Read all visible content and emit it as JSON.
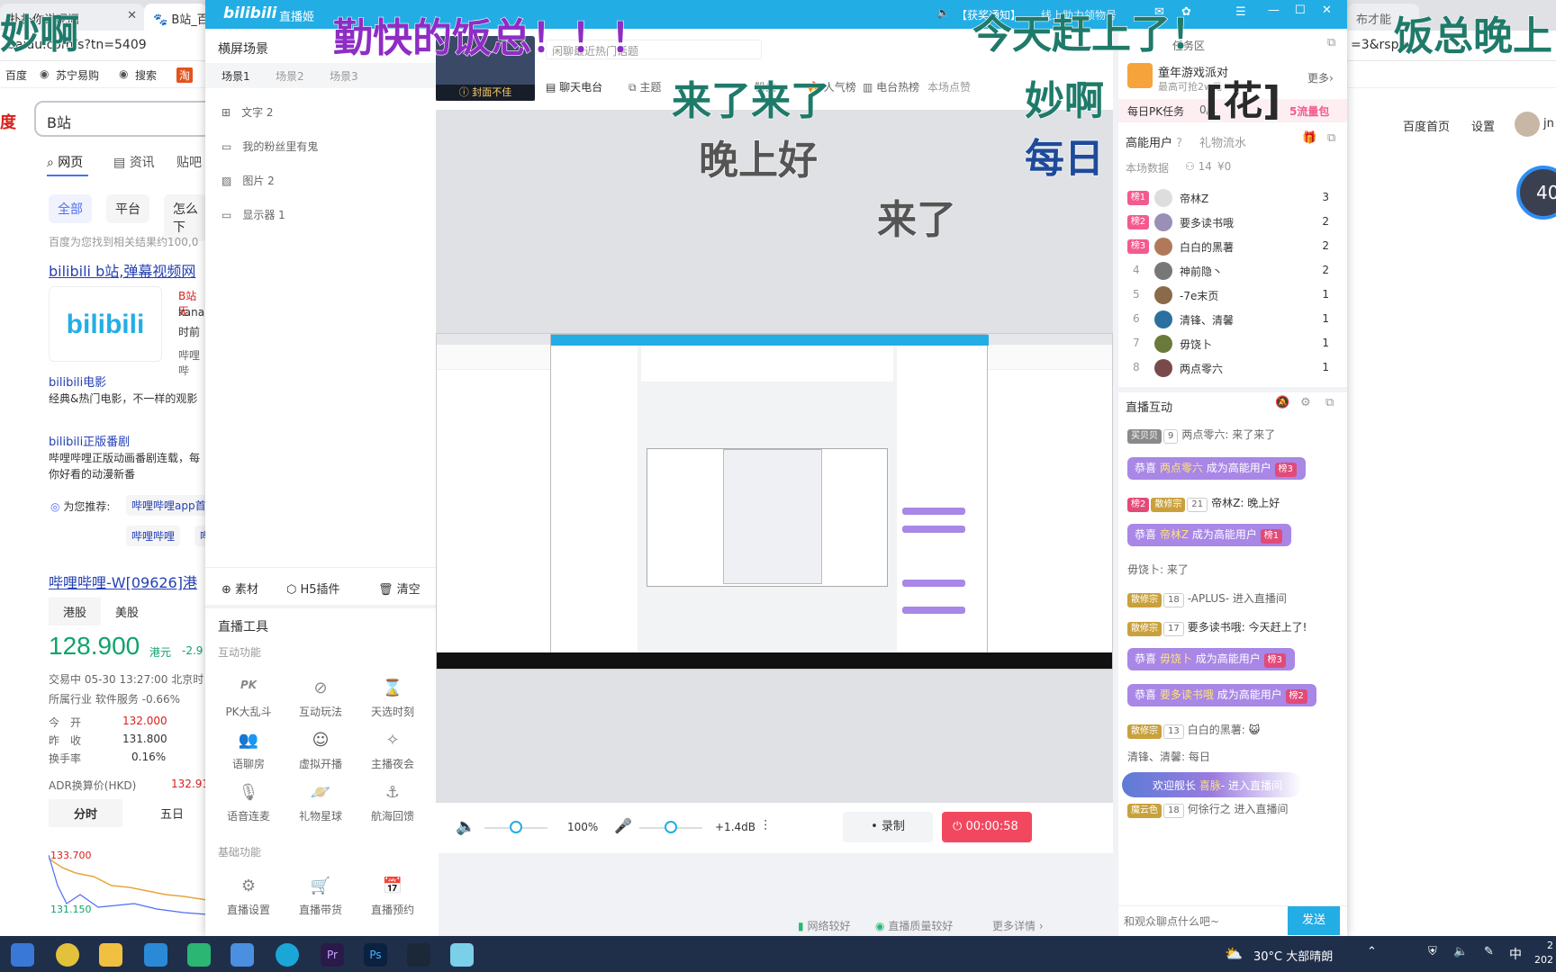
{
  "browser": {
    "tabs": [
      "扑扑你说呢问",
      "B站_百度"
    ],
    "url": "baidu.com/s?tn=5409",
    "url_tail": "=3&rsp=",
    "right_tab": "布才能",
    "bookmarks": [
      "百度",
      "苏宁易购",
      "搜索"
    ],
    "search_value": "B站",
    "search_tabs": [
      "网页",
      "资讯",
      "贴吧"
    ],
    "filters": [
      "全部",
      "平台",
      "怎么下"
    ],
    "result_count": "百度为您找到相关结果约100,0",
    "result1_title": "bilibili b站,弹幕视频网",
    "result1_snippet": [
      "B站无",
      "kana",
      "时前",
      "哔哩哔"
    ],
    "logo_text": "bilibili",
    "sub1_title": "bilibili电影",
    "sub1_desc": "经典&热门电影，不一样的观影",
    "sub2_title": "bilibili正版番剧",
    "sub2_desc": "哔哩哔哩正版动画番剧连载，每",
    "sub2_desc2": "你好看的动漫新番",
    "recommend_label": "为您推荐:",
    "recommend_items": [
      "哔哩哔哩app首",
      "哔哩哔哩",
      "哔"
    ],
    "stock_title": "哔哩哔哩-W[09626]港",
    "stock_tabs": [
      "港股",
      "美股"
    ],
    "stock_price": "128.900",
    "stock_unit": "港元",
    "stock_change": "-2.9",
    "stock_status": "交易中 05-30 13:27:00 北京时",
    "stock_industry": "所属行业 软件服务 -0.66%",
    "stock_rows": [
      {
        "k": "今　开",
        "v": "132.000"
      },
      {
        "k": "昨　收",
        "v": "131.800"
      },
      {
        "k": "换手率",
        "v": "0.16%"
      }
    ],
    "adr_label": "ADR换算价(HKD)",
    "adr_value": "132.91",
    "period_tabs": [
      "分时",
      "五日"
    ],
    "chart_high": "133.700",
    "chart_low": "131.150",
    "right_nav": [
      "百度首页",
      "设置"
    ],
    "right_user": "jn",
    "right_badge": "40"
  },
  "live": {
    "app_title": "直播姬",
    "title_notice": "【获奖通知】",
    "title_notice2": "线上助力领物号",
    "scene_panel_title": "横屏场景",
    "scene_tabs": [
      "场景1",
      "场景2",
      "场景3"
    ],
    "scene_items": [
      "文字 2",
      "我的粉丝里有鬼",
      "图片 2",
      "显示器 1"
    ],
    "scene_actions": [
      "素材",
      "H5插件",
      "清空"
    ],
    "tools_title": "直播工具",
    "interactive_title": "互动功能",
    "interactive_tools": [
      "PK大乱斗",
      "互动玩法",
      "天选时刻",
      "语聊房",
      "虚拟开播",
      "主播夜会",
      "语音连麦",
      "礼物星球",
      "航海回馈"
    ],
    "basic_title": "基础功能",
    "basic_tools": [
      "直播设置",
      "直播带货",
      "直播预约"
    ],
    "room_title_placeholder": "闲聊最近热门话题",
    "cover_label": "封面不佳",
    "room_tabs": [
      "聊天电台",
      "主题",
      "粉丝",
      "人气榜",
      "电台热榜"
    ],
    "room_tail": "本场点赞",
    "volume": "100%",
    "mic_gain": "+1.4dB",
    "record_label": "录制",
    "timer": "00:00:58",
    "status_network": "网络较好",
    "status_quality": "直播质量较好",
    "status_more": "更多详情",
    "task_area": "任务区",
    "event_title": "童年游戏派对",
    "event_sub": "最高可抢2w元",
    "event_more": "更多",
    "pk_task": "每日PK任务",
    "pk_progress": "0/1",
    "pk_reward": "5流量包",
    "high_users_tab": "高能用户",
    "gift_flow_tab": "礼物流水",
    "session_data_label": "本场数据",
    "session_viewers": "14",
    "session_money": "¥0",
    "rank": [
      {
        "rank": "榜1",
        "name": "帝林Z",
        "score": "3"
      },
      {
        "rank": "榜2",
        "name": "要多读书哦",
        "score": "2"
      },
      {
        "rank": "榜3",
        "name": "白白的黑薯",
        "score": "2"
      },
      {
        "rank": "4",
        "name": "神前隐丶",
        "score": "2"
      },
      {
        "rank": "5",
        "name": "-7e末页",
        "score": "1"
      },
      {
        "rank": "6",
        "name": "清锋、清馨",
        "score": "1"
      },
      {
        "rank": "7",
        "name": "毋饶卜",
        "score": "1"
      },
      {
        "rank": "8",
        "name": "两点零六",
        "score": "1"
      }
    ],
    "interaction_title": "直播互动",
    "messages": [
      {
        "medal": "买贝贝",
        "lv": "9",
        "text": "两点零六: 来了来了"
      },
      {
        "sys_pre": "恭喜",
        "sys_name": "两点零六",
        "sys_post": "成为高能用户",
        "badge": "榜3"
      },
      {
        "medal0": "榜2",
        "medal": "散修宗",
        "lv": "21",
        "text": "帝林Z: 晚上好"
      },
      {
        "sys_pre": "恭喜",
        "sys_name": "帝林Z",
        "sys_post": "成为高能用户",
        "badge": "榜1"
      },
      {
        "text": "毋饶卜: 来了"
      },
      {
        "medal": "散修宗",
        "lv": "18",
        "text": "-APLUS- 进入直播间"
      },
      {
        "medal": "散修宗",
        "lv": "17",
        "text": "要多读书哦: 今天赶上了!"
      },
      {
        "sys_pre": "恭喜",
        "sys_name": "毋饶卜",
        "sys_post": "成为高能用户",
        "badge": "榜3"
      },
      {
        "sys_pre": "恭喜",
        "sys_name": "要多读书哦",
        "sys_post": "成为高能用户",
        "badge": "榜2"
      },
      {
        "medal": "散修宗",
        "lv": "13",
        "text": "白白的黑薯:"
      },
      {
        "text": "清锋、清馨: 每日"
      },
      {
        "welcome": "欢迎舰长",
        "welcome_name": "喜脉",
        "welcome_post": "进入直播间"
      },
      {
        "medal": "魔云色",
        "lv": "18",
        "text": "何徐行之 进入直播间"
      }
    ],
    "chat_placeholder": "和观众聊点什么吧~",
    "send_label": "发送"
  },
  "danmaku": [
    "妙啊",
    "勤快的饭总！！！",
    "今天赶上了！",
    "饭总晚上",
    "来了来了",
    "妙啊",
    "[花]",
    "晚上好",
    "每日",
    "来了"
  ],
  "taskbar": {
    "weather": "30°C 大部晴朗",
    "ime": "中",
    "clock_line1": "2",
    "clock_line2": "202"
  }
}
